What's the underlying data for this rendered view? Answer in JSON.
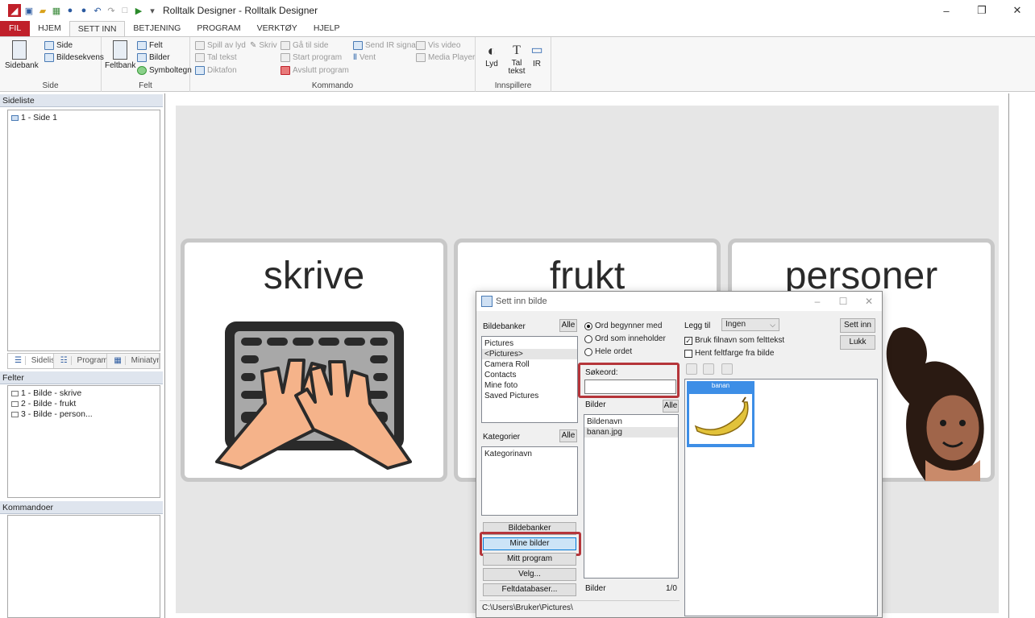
{
  "window": {
    "title": "Rolltalk Designer - Rolltalk Designer",
    "minimize": "–",
    "maximize": "❐",
    "close": "✕"
  },
  "ribbon_tabs": [
    "FIL",
    "HJEM",
    "SETT INN",
    "BETJENING",
    "PROGRAM",
    "VERKTØY",
    "HJELP"
  ],
  "ribbon": {
    "side_group": {
      "label": "Side",
      "sidebank": "Sidebank",
      "side": "Side",
      "bildesekvens": "Bildesekvens"
    },
    "felt_group": {
      "label": "Felt",
      "feltbank": "Feltbank",
      "felt": "Felt",
      "bilder": "Bilder",
      "symboltegn": "Symboltegn"
    },
    "kommando_group": {
      "label": "Kommando",
      "spill_av_lyd": "Spill av lyd",
      "skriv": "Skriv",
      "tal_tekst": "Tal tekst",
      "diktafon": "Diktafon",
      "ga_til_side": "Gå til side",
      "start_program": "Start program",
      "avslutt_program": "Avslutt program",
      "send_ir_signal": "Send IR signal",
      "vent": "Vent",
      "vis_video": "Vis video",
      "media_player": "Media Player"
    },
    "innspillere_group": {
      "label": "Innspillere",
      "lyd": "Lyd",
      "tal_tekst_1": "Tal",
      "tal_tekst_2": "tekst",
      "ir": "IR"
    }
  },
  "sideliste": {
    "header": "Sideliste",
    "items": [
      "1 - Side 1"
    ],
    "tabs": [
      "Sideliste",
      "Programs...",
      "Miniatyrs..."
    ]
  },
  "felter": {
    "header": "Felter",
    "items": [
      "1 - Bilde - skrive",
      "2 - Bilde - frukt",
      "3 - Bilde - person..."
    ]
  },
  "kommandoer": {
    "header": "Kommandoer"
  },
  "cards": [
    {
      "title": "skrive"
    },
    {
      "title": "frukt"
    },
    {
      "title": "personer"
    }
  ],
  "dialog": {
    "title": "Sett inn bilde",
    "bildebanker_label": "Bildebanker",
    "alle": "Alle",
    "bildebanker_items": [
      "Pictures",
      "<Pictures>",
      "Camera Roll",
      "Contacts",
      "Mine foto",
      "Saved Pictures"
    ],
    "kategorier_label": "Kategorier",
    "kategorier_items": [
      "Kategorinavn"
    ],
    "btn_bildebanker": "Bildebanker",
    "btn_mine_bilder": "Mine bilder",
    "btn_mitt_program": "Mitt program",
    "btn_velg": "Velg...",
    "btn_feltdatabaser": "Feltdatabaser...",
    "path": "C:\\Users\\Bruker\\Pictures\\",
    "radio_begynner": "Ord begynner med",
    "radio_inneholder": "Ord som inneholder",
    "radio_hele": "Hele ordet",
    "sokeord_label": "Søkeord:",
    "sokeord_value": "",
    "bilder_label": "Bilder",
    "bilder_items": [
      "Bildenavn",
      "banan.jpg"
    ],
    "bilder_footer_label": "Bilder",
    "bilder_count": "1/0",
    "legg_til_label": "Legg til",
    "legg_til_value": "Ingen",
    "chk_filnavn": "Bruk filnavn som felttekst",
    "chk_feltfarge": "Hent feltfarge fra bilde",
    "btn_sett_inn": "Sett inn",
    "btn_lukk": "Lukk",
    "thumb_name": "banan"
  }
}
